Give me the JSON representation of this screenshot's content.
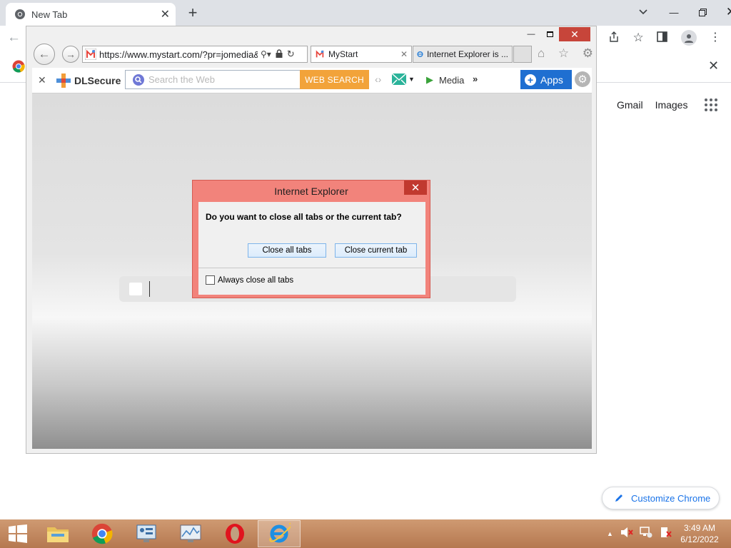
{
  "chrome": {
    "tab_title": "New Tab",
    "links": {
      "gmail": "Gmail",
      "images": "Images"
    },
    "customize_label": "Customize Chrome"
  },
  "ie": {
    "address": "https://www.mystart.com/?pr=jomedia&",
    "tabs": [
      {
        "label": "MyStart",
        "active": true
      },
      {
        "label": "Internet Explorer is ...",
        "active": false
      }
    ],
    "toolbar": {
      "brand": "DLSecure",
      "search_placeholder": "Search the Web",
      "search_button": "WEB SEARCH",
      "media_label": "Media",
      "more_label": "»",
      "apps_label": "Apps"
    }
  },
  "dialog": {
    "title": "Internet Explorer",
    "question": "Do you want to close all tabs or the current tab?",
    "close_all": "Close all tabs",
    "close_current": "Close current tab",
    "checkbox_label": "Always close all tabs",
    "checkbox_checked": false
  },
  "taskbar": {
    "apps": [
      "start",
      "file-explorer",
      "chrome",
      "control-panel",
      "resource-monitor",
      "opera",
      "internet-explorer"
    ],
    "active_app": "internet-explorer",
    "time": "3:49 AM",
    "date": "6/12/2022"
  },
  "colors": {
    "dialog_frame": "#f2837b",
    "dialog_close": "#c1392f",
    "web_search": "#f2a33a",
    "apps_button": "#1f6fd1",
    "taskbar": "#c08a60"
  }
}
